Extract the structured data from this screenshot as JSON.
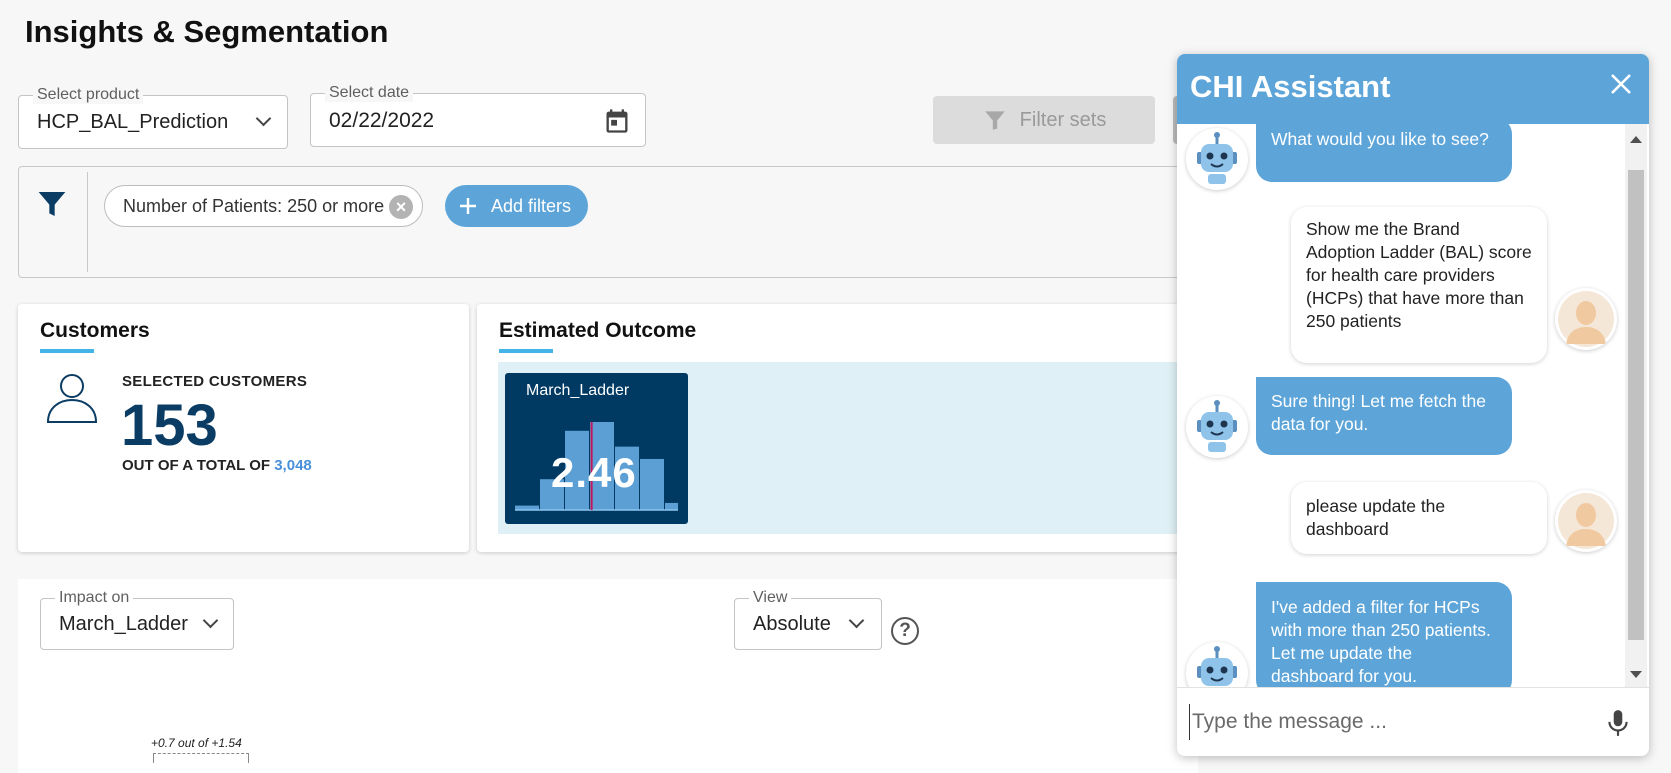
{
  "page": {
    "title": "Insights & Segmentation"
  },
  "controls": {
    "product": {
      "label": "Select product",
      "value": "HCP_BAL_Prediction"
    },
    "date": {
      "label": "Select date",
      "value": "02/22/2022"
    },
    "filter_sets_label": "Filter sets"
  },
  "filters": {
    "chips": [
      {
        "label": "Number of Patients: 250 or more"
      }
    ],
    "add_label": "Add filters"
  },
  "customers": {
    "title": "Customers",
    "selected_label": "SELECTED CUSTOMERS",
    "count": "153",
    "out_of_label": "OUT OF A TOTAL OF",
    "total": "3,048"
  },
  "outcome": {
    "title": "Estimated Outcome",
    "ladder": {
      "name": "March_Ladder",
      "value": "2.46",
      "histogram": [
        0.05,
        0.35,
        0.9,
        1.0,
        0.72,
        0.58,
        0.08,
        0.02
      ],
      "marker": 0.47
    }
  },
  "impact": {
    "impact_on": {
      "label": "Impact on",
      "value": "March_Ladder"
    },
    "view": {
      "label": "View",
      "value": "Absolute"
    },
    "help_glyph": "?",
    "annotation": "+0.7 out of +1.54"
  },
  "chat": {
    "title": "CHI Assistant",
    "input_placeholder": "Type the message ...",
    "messages": [
      {
        "role": "bot",
        "text": "What would you like to see?"
      },
      {
        "role": "user",
        "text": "Show me the Brand Adoption Ladder (BAL) score for health care providers (HCPs) that have more than 250 patients"
      },
      {
        "role": "bot",
        "text": "Sure thing! Let me fetch the data for you."
      },
      {
        "role": "user",
        "text": "please update the dashboard"
      },
      {
        "role": "bot",
        "text": "I've added a filter for HCPs with more than 250 patients. Let me update the dashboard for you."
      }
    ]
  },
  "colors": {
    "accent": "#5da5d9",
    "navy": "#003a63",
    "underline": "#44b3e8",
    "link": "#4a90d9"
  },
  "icons": [
    "chevron-down-icon",
    "calendar-icon",
    "funnel-icon",
    "close-icon",
    "plus-icon",
    "person-icon",
    "help-icon",
    "robot-icon",
    "user-avatar-icon",
    "mic-icon"
  ]
}
